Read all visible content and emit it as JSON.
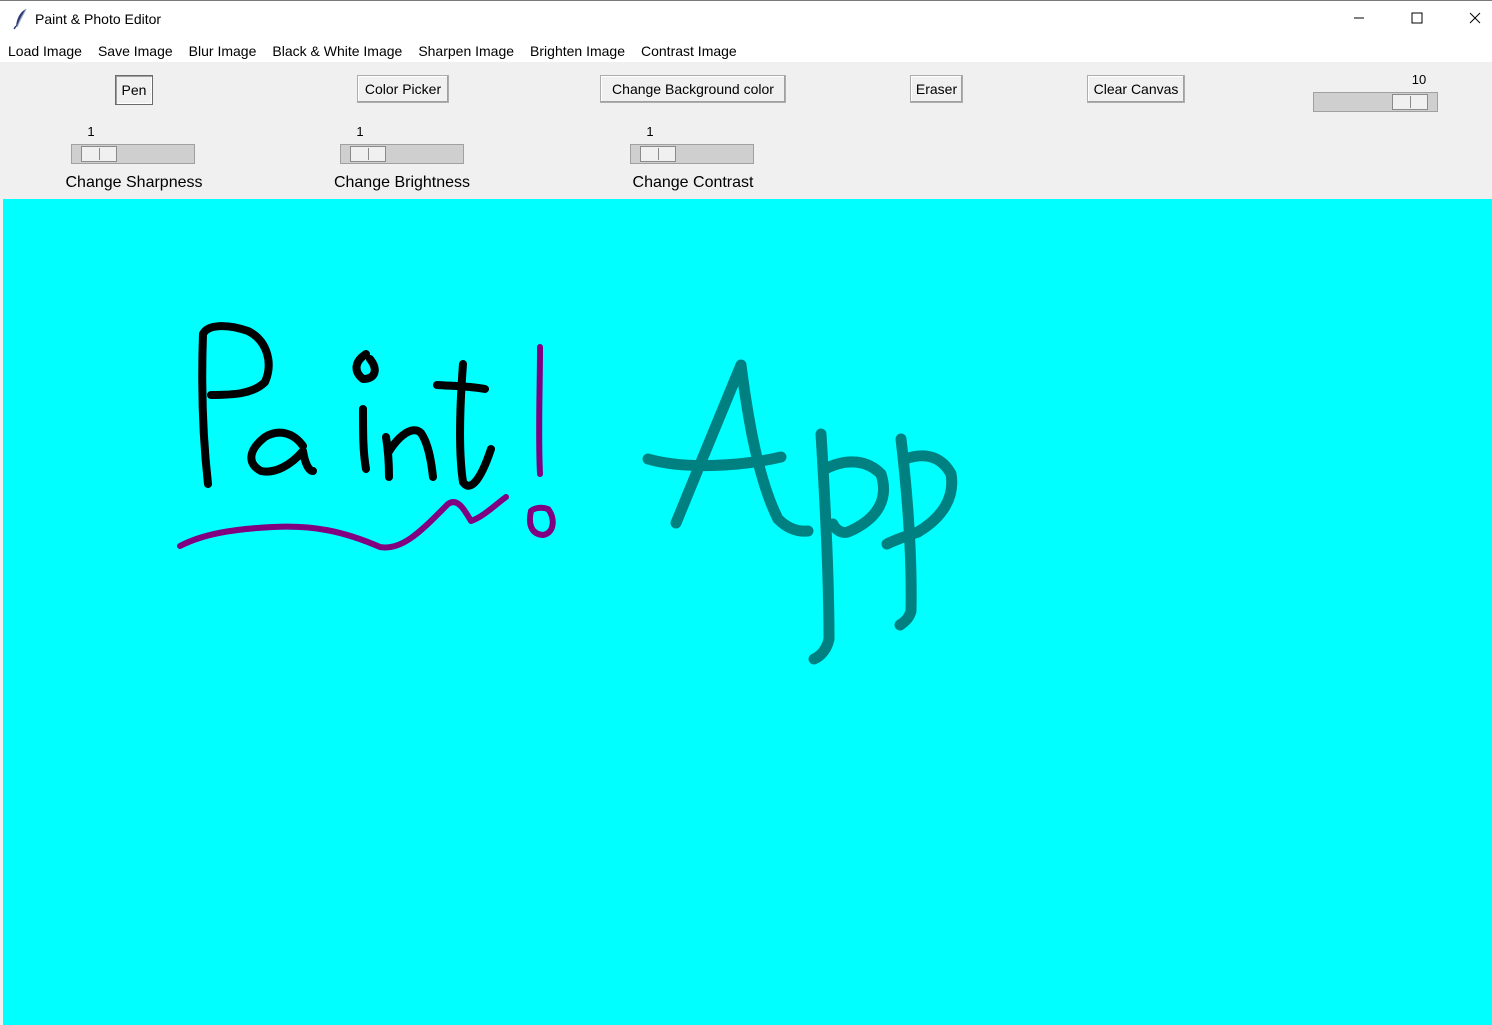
{
  "window": {
    "title": "Paint & Photo Editor",
    "app_icon": "feather-icon",
    "controls": {
      "minimize_icon": "minimize-icon",
      "maximize_icon": "maximize-icon",
      "close_icon": "close-icon"
    }
  },
  "menu": {
    "items": [
      {
        "label": "Load Image"
      },
      {
        "label": "Save Image"
      },
      {
        "label": "Blur Image"
      },
      {
        "label": "Black & White Image"
      },
      {
        "label": "Sharpen Image"
      },
      {
        "label": "Brighten Image"
      },
      {
        "label": "Contrast Image"
      }
    ]
  },
  "toolbar": {
    "pen_label": "Pen",
    "color_picker_label": "Color Picker",
    "change_bg_label": "Change Background color",
    "eraser_label": "Eraser",
    "clear_canvas_label": "Clear Canvas",
    "brush_size": {
      "value": "10",
      "level": 0.9
    },
    "sharpness": {
      "value": "1",
      "label": "Change Sharpness",
      "level": 0.1
    },
    "brightness": {
      "value": "1",
      "label": "Change Brightness",
      "level": 0.1
    },
    "contrast": {
      "value": "1",
      "label": "Change Contrast",
      "level": 0.1
    }
  },
  "canvas": {
    "background_color": "#00ffff",
    "strokes": [
      {
        "name": "paint-word-stroke",
        "color": "#000000"
      },
      {
        "name": "underline-stroke",
        "color": "#800080"
      },
      {
        "name": "exclamation-stroke",
        "color": "#800080"
      },
      {
        "name": "app-word-stroke",
        "color": "#008080"
      }
    ]
  }
}
